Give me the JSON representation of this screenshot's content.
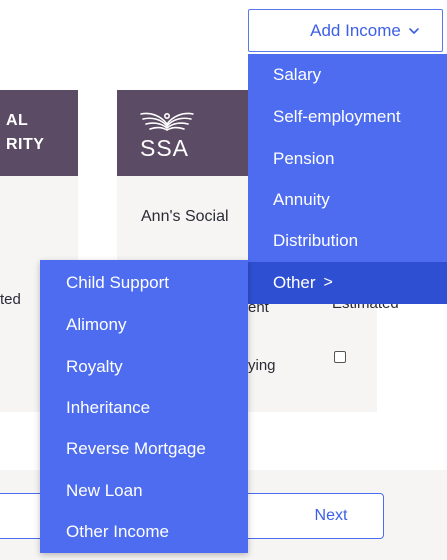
{
  "cards": [
    {
      "header_line1": "AL",
      "header_line2": "RITY"
    },
    {
      "logo_text": "SSA",
      "name": "Ann's Social"
    }
  ],
  "row_fragments": {
    "ted": "ted",
    "ent": "ent",
    "estimated": "Estimated",
    "ying": "ying"
  },
  "add_income": {
    "label": "Add Income",
    "menu": [
      "Salary",
      "Self-employment",
      "Pension",
      "Annuity",
      "Distribution",
      "Other"
    ],
    "other_caret": ">",
    "submenu": [
      "Child Support",
      "Alimony",
      "Royalty",
      "Inheritance",
      "Reverse Mortgage",
      "New Loan",
      "Other Income"
    ]
  },
  "footer": {
    "next_label": "Next"
  },
  "colors": {
    "accent": "#4d6cf0",
    "accent_active": "#2f4fd2",
    "card_header": "#5b4b64",
    "card_body": "#f6f5f3"
  }
}
